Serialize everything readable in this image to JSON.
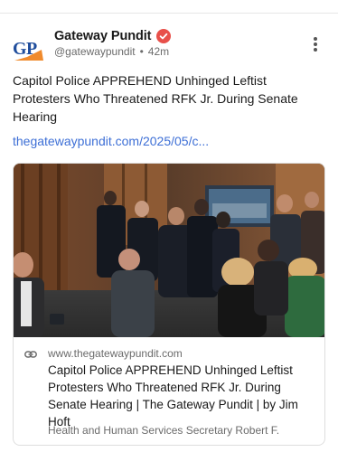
{
  "author": {
    "display_name": "Gateway Pundit",
    "handle": "@gatewaypundit",
    "separator": "•",
    "timestamp": "42m",
    "avatar_icon": "gp-logo-icon",
    "verified_icon": "verified-badge-icon"
  },
  "post": {
    "text": "Capitol Police APPREHEND Unhinged Leftist Protesters Who Threatened RFK Jr. During Senate Hearing",
    "link_text": "thegatewaypundit.com/2025/05/c..."
  },
  "card": {
    "domain": "www.thegatewaypundit.com",
    "title": "Capitol Police APPREHEND Unhinged Leftist Protesters Who Threatened RFK Jr. During Senate Hearing | The Gateway Pundit | by Jim Hoft",
    "description": "Health and Human Services Secretary Robert F.",
    "link_icon": "link-icon"
  },
  "colors": {
    "link": "#3d6fd6",
    "verified": "#e8504a",
    "logo_blue": "#1f4d9c",
    "logo_orange": "#f08a2c"
  }
}
